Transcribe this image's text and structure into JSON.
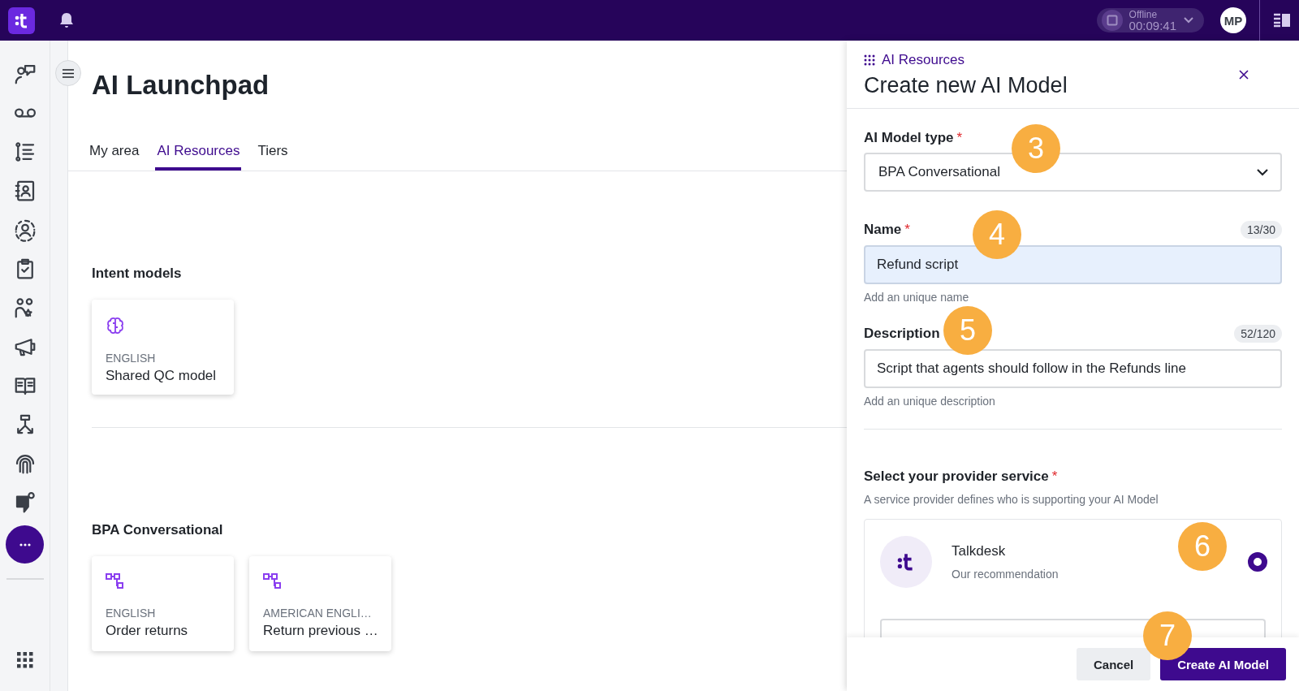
{
  "topbar": {
    "status": {
      "label": "Offline",
      "timer": "00:09:41"
    },
    "avatar": "MP"
  },
  "sidebar": {
    "more_selected": true
  },
  "page": {
    "title": "AI Launchpad",
    "tabs": [
      {
        "label": "My area",
        "selected": false
      },
      {
        "label": "AI Resources",
        "selected": true
      },
      {
        "label": "Tiers",
        "selected": false
      }
    ],
    "sections": [
      {
        "title": "Intent models",
        "cards": [
          {
            "kind": "intent",
            "language": "ENGLISH",
            "name": "Shared QC model"
          }
        ]
      },
      {
        "title": "BPA Conversational",
        "cards": [
          {
            "kind": "flow",
            "language": "ENGLISH",
            "name": "Order returns"
          },
          {
            "kind": "flow",
            "language": "AMERICAN ENGLI…",
            "name": "Return previous …"
          }
        ]
      }
    ]
  },
  "panel": {
    "breadcrumb": "AI Resources",
    "title": "Create new AI Model",
    "fields": [
      {
        "kind": "select",
        "label": "AI Model type",
        "marker": "*",
        "value": "BPA Conversational"
      },
      {
        "kind": "text",
        "label": "Name",
        "marker": "*",
        "counter": "13/30",
        "value": "Refund script",
        "hint": "Add an unique name",
        "focused": true
      },
      {
        "kind": "text",
        "label": "Description",
        "counter": "52/120",
        "value": "Script that agents should follow in the Refunds line",
        "hint": "Add an unique description",
        "focused": false
      }
    ],
    "provider": {
      "title": "Select your provider service",
      "marker": "*",
      "description": "A service provider defines who is supporting your AI Model",
      "options": [
        {
          "name": "Talkdesk",
          "subtitle": "Our recommendation",
          "selected": true
        }
      ]
    },
    "buttons": [
      {
        "label": "Cancel",
        "kind": "secondary"
      },
      {
        "label": "Create AI Model",
        "kind": "primary"
      }
    ]
  },
  "annotations": [
    {
      "number": "3"
    },
    {
      "number": "4"
    },
    {
      "number": "5"
    },
    {
      "number": "6"
    },
    {
      "number": "7"
    }
  ]
}
